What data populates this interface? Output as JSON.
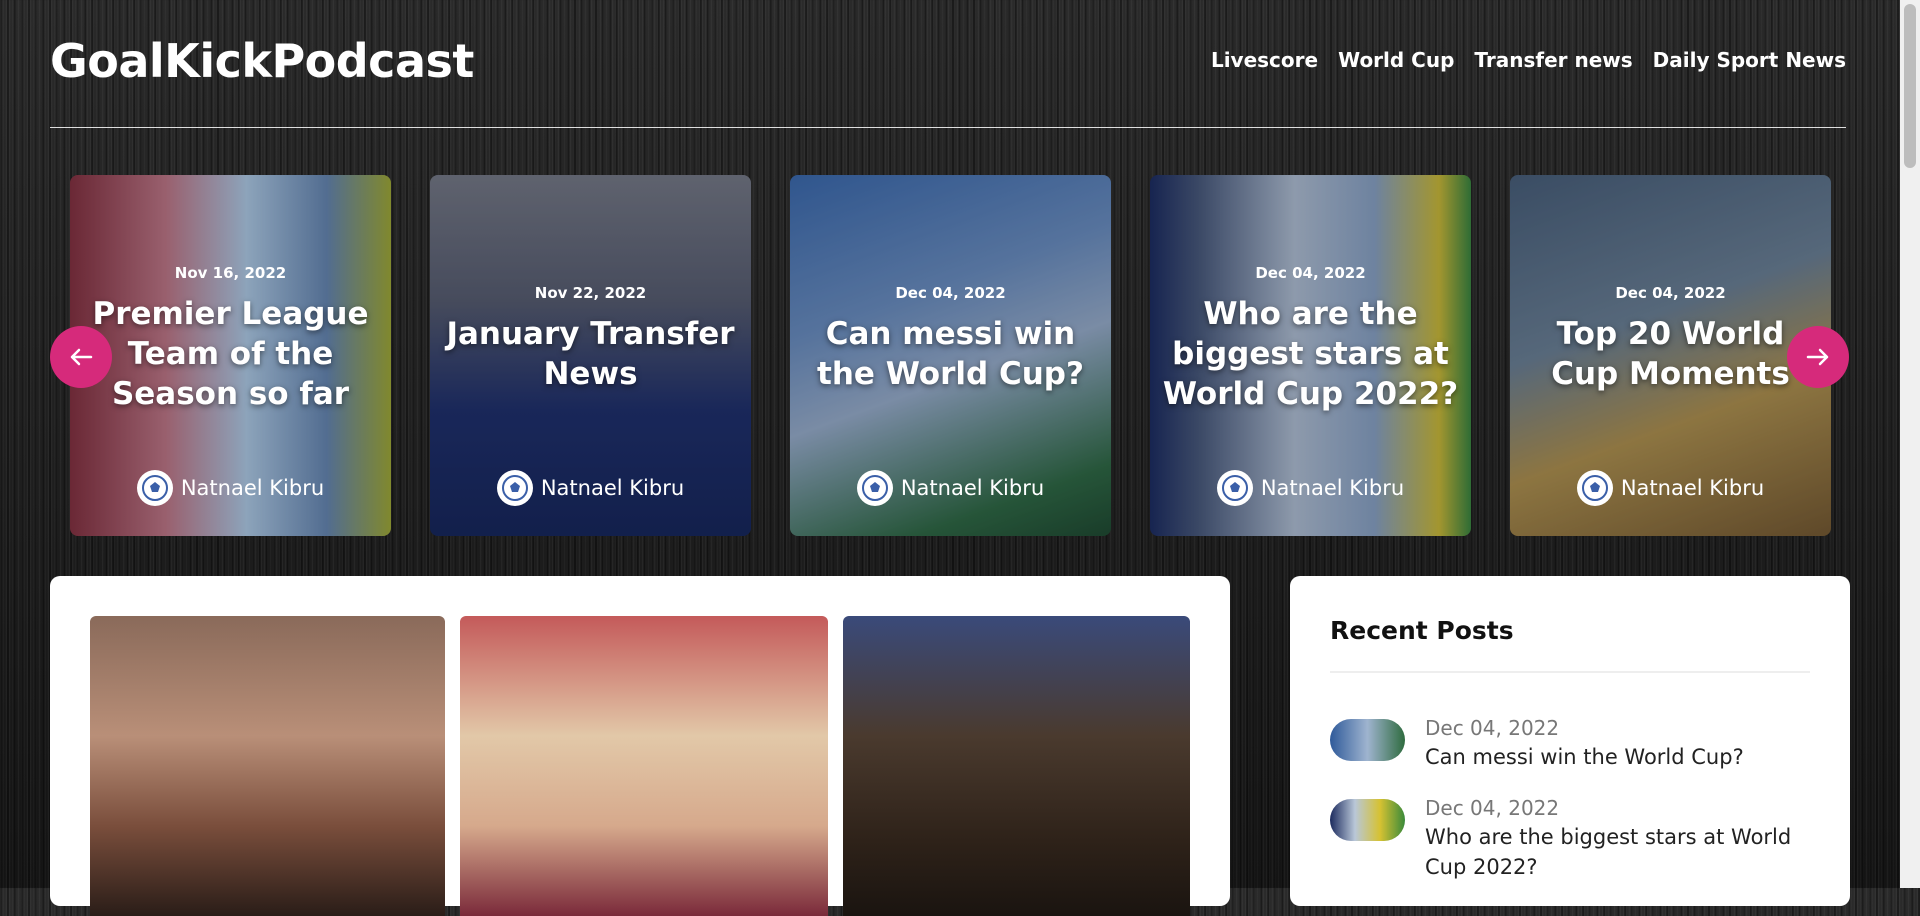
{
  "site": {
    "logo": "GoalKickPodcast"
  },
  "nav": [
    "Livescore",
    "World Cup",
    "Transfer news",
    "Daily Sport News"
  ],
  "slider": {
    "cards": [
      {
        "date": "Nov 16, 2022",
        "title": "Premier League Team of the Season so far",
        "author": "Natnael Kibru"
      },
      {
        "date": "Nov 22, 2022",
        "title": "January Transfer News",
        "author": "Natnael Kibru"
      },
      {
        "date": "Dec 04, 2022",
        "title": "Can messi win the World Cup?",
        "author": "Natnael Kibru"
      },
      {
        "date": "Dec 04, 2022",
        "title": "Who are the biggest stars at World Cup 2022?",
        "author": "Natnael Kibru"
      },
      {
        "date": "Dec 04, 2022",
        "title": "Top 20 World Cup Moments",
        "author": "Natnael Kibru"
      }
    ],
    "prev_icon": "arrow-left-icon",
    "next_icon": "arrow-right-icon",
    "accent": "#d62a7b"
  },
  "recent": {
    "title": "Recent Posts",
    "posts": [
      {
        "date": "Dec 04, 2022",
        "title": "Can messi win the World Cup?"
      },
      {
        "date": "Dec 04, 2022",
        "title": "Who are the biggest stars at World Cup 2022?"
      }
    ]
  }
}
